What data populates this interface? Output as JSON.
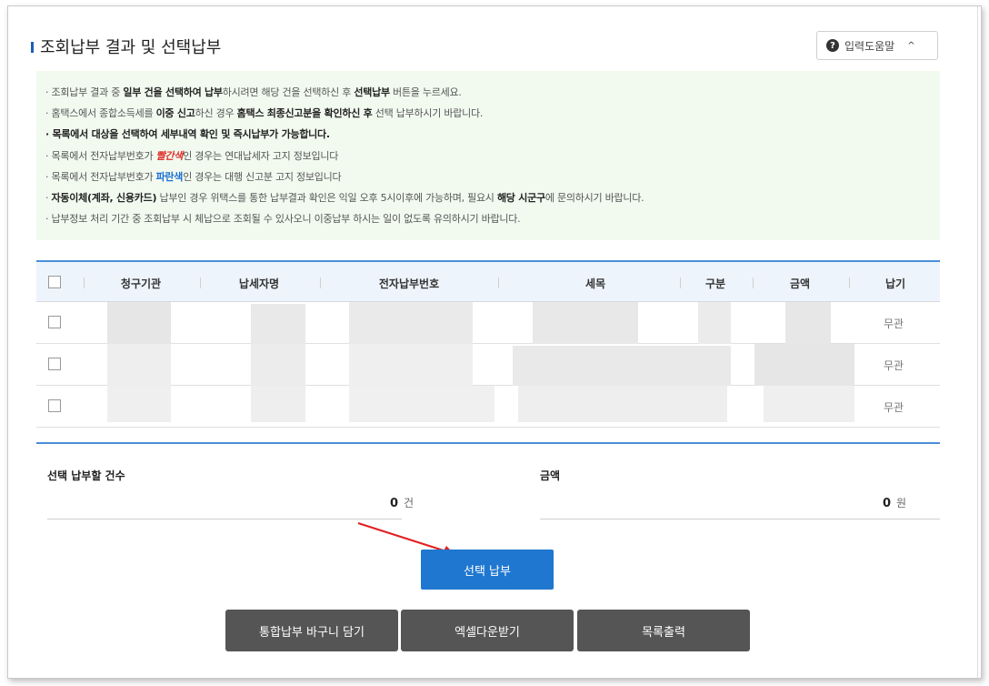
{
  "section_title": "조회납부 결과 및 선택납부",
  "help_button": {
    "label": "입력도움말",
    "icon": "help-circle-icon",
    "chevron": "^"
  },
  "notice": {
    "l1": {
      "a": "· 조회납부 결과 중 ",
      "b": "일부 건을 선택하여 납부",
      "c": "하시려면 해당 건을 선택하신 후 ",
      "d": "선택납부",
      "e": " 버튼을 누르세요."
    },
    "l2": {
      "a": "· 홈택스에서 종합소득세를 ",
      "b": "이중 신고",
      "c": "하신 경우 ",
      "d": "홈택스 최종신고분을 확인하신 후",
      "e": " 선택 납부하시기 바랍니다."
    },
    "l3": "· 목록에서 대상을 선택하여 세부내역 확인 및 즉시납부가 가능합니다.",
    "l4": {
      "a": "· 목록에서 전자납부번호가 ",
      "b": "빨간색",
      "c": "인 경우는 연대납세자 고지 정보입니다"
    },
    "l5": {
      "a": "· 목록에서 전자납부번호가 ",
      "b": "파란색",
      "c": "인 경우는 대행 신고분 고지 정보입니다"
    },
    "l6": {
      "a": "· ",
      "b": "자동이체(계좌, 신용카드)",
      "c": " 납부인 경우 위택스를 통한 납부결과 확인은 익일 오후 5시이후에 가능하며, 필요시 ",
      "d": "해당 시군구",
      "e": "에 문의하시기 바랍니다."
    },
    "l7": "· 납부정보 처리 기간 중 조회납부 시 체납으로 조회될 수 있사오니 이중납부 하시는 일이 없도록 유의하시기 바랍니다."
  },
  "table": {
    "headers": {
      "agency": "청구기관",
      "taxpayer": "납세자명",
      "epay_no": "전자납부번호",
      "tax_item": "세목",
      "type": "구분",
      "amount": "금액",
      "due": "납기"
    },
    "rows": [
      {
        "due": "무관"
      },
      {
        "due": "무관"
      },
      {
        "due": "무관"
      }
    ]
  },
  "summary": {
    "count_label": "선택 납부할 건수",
    "count_value": "0",
    "count_unit": "건",
    "amount_label": "금액",
    "amount_value": "0",
    "amount_unit": "원"
  },
  "buttons": {
    "select_pay": "선택 납부",
    "basket": "통합납부 바구니 담기",
    "excel": "엑셀다운받기",
    "print": "목록출력"
  },
  "colors": {
    "accent": "#1f77d0",
    "notice_bg": "#f2faf0",
    "header_bg": "#eef4fb",
    "red_text": "#e0302a",
    "blue_text": "#1a6fd1",
    "gray_button": "#555555",
    "arrow": "#e02020"
  }
}
